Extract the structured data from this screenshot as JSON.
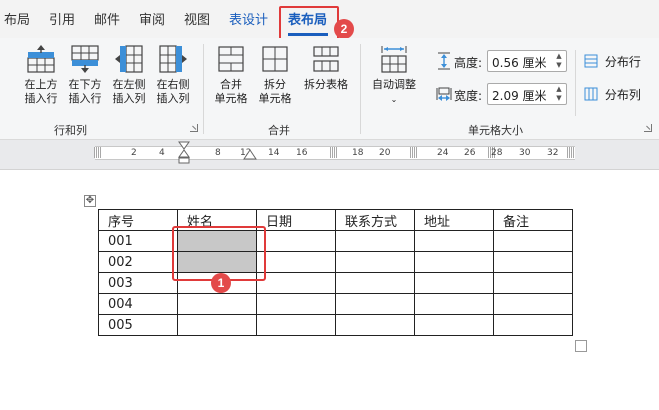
{
  "tabs": [
    {
      "label": "布局"
    },
    {
      "label": "引用"
    },
    {
      "label": "邮件"
    },
    {
      "label": "审阅"
    },
    {
      "label": "视图"
    },
    {
      "label": "表设计"
    },
    {
      "label": "表布局"
    }
  ],
  "badges": {
    "one": "1",
    "two": "2"
  },
  "ribbon": {
    "rows_cols": {
      "insert_above": [
        "在上方",
        "插入行"
      ],
      "insert_below": [
        "在下方",
        "插入行"
      ],
      "insert_left": [
        "在左侧",
        "插入列"
      ],
      "insert_right": [
        "在右侧",
        "插入列"
      ],
      "group_label": "行和列"
    },
    "merge": {
      "merge_cells": [
        "合并",
        "单元格"
      ],
      "split_cells": [
        "拆分",
        "单元格"
      ],
      "split_table": "拆分表格",
      "group_label": "合并"
    },
    "cell_size": {
      "autofit": "自动调整",
      "height_label": "高度:",
      "height_value": "0.56 厘米",
      "width_label": "宽度:",
      "width_value": "2.09 厘米",
      "distribute_rows": "分布行",
      "distribute_cols": "分布列",
      "group_label": "单元格大小"
    }
  },
  "ruler": {
    "numbers": [
      "2",
      "4",
      "8",
      "12",
      "14",
      "16",
      "18",
      "20",
      "24",
      "26",
      "28",
      "30",
      "32"
    ]
  },
  "table": {
    "headers": [
      "序号",
      "姓名",
      "日期",
      "联系方式",
      "地址",
      "备注"
    ],
    "rows": [
      [
        "001",
        "",
        "",
        "",
        "",
        ""
      ],
      [
        "002",
        "",
        "",
        "",
        "",
        ""
      ],
      [
        "003",
        "",
        "",
        "",
        "",
        ""
      ],
      [
        "004",
        "",
        "",
        "",
        "",
        ""
      ],
      [
        "005",
        "",
        "",
        "",
        "",
        ""
      ]
    ]
  },
  "colors": {
    "accent": "#1a5ebd",
    "highlight": "#e03a3a",
    "badge": "#e34a4a",
    "selected_cell": "#c8c8c8"
  },
  "icons": [
    "insert-row-above-icon",
    "insert-row-below-icon",
    "insert-column-left-icon",
    "insert-column-right-icon",
    "merge-cells-icon",
    "split-cells-icon",
    "split-table-icon",
    "autofit-icon",
    "row-height-icon",
    "column-width-icon",
    "distribute-rows-icon",
    "distribute-columns-icon",
    "table-move-handle-icon"
  ]
}
